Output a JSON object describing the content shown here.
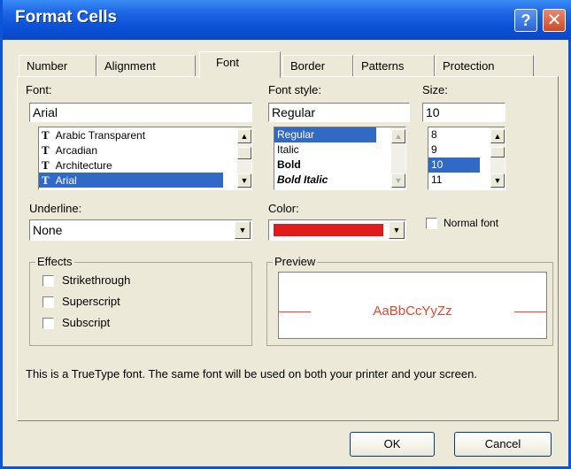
{
  "window": {
    "title": "Format Cells"
  },
  "titlebar": {
    "help_label": "?",
    "close_label": "✕"
  },
  "tabs": [
    {
      "label": "Number"
    },
    {
      "label": "Alignment"
    },
    {
      "label": "Font",
      "active": true
    },
    {
      "label": "Border"
    },
    {
      "label": "Patterns"
    },
    {
      "label": "Protection"
    }
  ],
  "font": {
    "label": "Font:",
    "value": "Arial",
    "items": [
      "Arabic Transparent",
      "Arcadian",
      "Architecture",
      "Arial"
    ],
    "selected": "Arial"
  },
  "font_style": {
    "label": "Font style:",
    "value": "Regular",
    "items": [
      "Regular",
      "Italic",
      "Bold",
      "Bold Italic"
    ],
    "selected": "Regular"
  },
  "size": {
    "label": "Size:",
    "value": "10",
    "items": [
      "8",
      "9",
      "10",
      "11"
    ],
    "selected": "10"
  },
  "underline": {
    "label": "Underline:",
    "value": "None"
  },
  "color": {
    "label": "Color:",
    "value": "#e01b1b"
  },
  "normal_font": {
    "label": "Normal font",
    "checked": false
  },
  "effects": {
    "title": "Effects",
    "items": [
      {
        "label": "Strikethrough",
        "checked": false
      },
      {
        "label": "Superscript",
        "checked": false
      },
      {
        "label": "Subscript",
        "checked": false
      }
    ]
  },
  "preview": {
    "title": "Preview",
    "sample": "AaBbCcYyZz",
    "color": "#e8452a"
  },
  "info_text": "This is a TrueType font.  The same font will be used on both your printer and your screen.",
  "buttons": {
    "ok": "OK",
    "cancel": "Cancel"
  },
  "icons": {
    "truetype": "T",
    "arrow_up": "▲",
    "arrow_down": "▼"
  }
}
